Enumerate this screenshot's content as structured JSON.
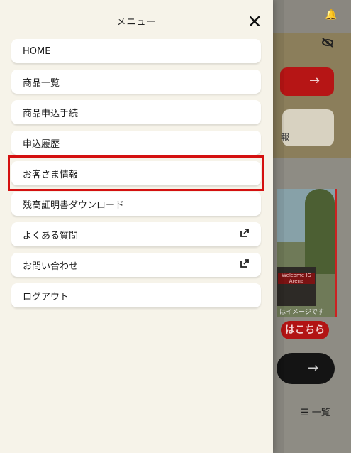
{
  "drawer": {
    "title": "メニュー",
    "close_icon": "close-icon",
    "items": [
      {
        "label": "HOME",
        "external": false
      },
      {
        "label": "商品一覧",
        "external": false
      },
      {
        "label": "商品申込手続",
        "external": false
      },
      {
        "label": "申込履歴",
        "external": false
      },
      {
        "label": "お客さま情報",
        "external": false,
        "highlighted": true
      },
      {
        "label": "残高証明書ダウンロード",
        "external": false
      },
      {
        "label": "よくある質問",
        "external": true
      },
      {
        "label": "お問い合わせ",
        "external": true
      },
      {
        "label": "ログアウト",
        "external": false
      }
    ]
  },
  "background": {
    "banner_caption": "はイメージです",
    "banner_link": "はこちら",
    "sign_text": "Welcome IG Arena",
    "card_text": "報",
    "list_label": "一覧",
    "icons": [
      "bell-icon",
      "eye-off-icon",
      "arrow-right-icon",
      "list-icon"
    ]
  },
  "colors": {
    "drawer_bg": "#f6f3e9",
    "item_bg": "#ffffff",
    "highlight": "#d41010",
    "accent_red": "#b61515"
  }
}
